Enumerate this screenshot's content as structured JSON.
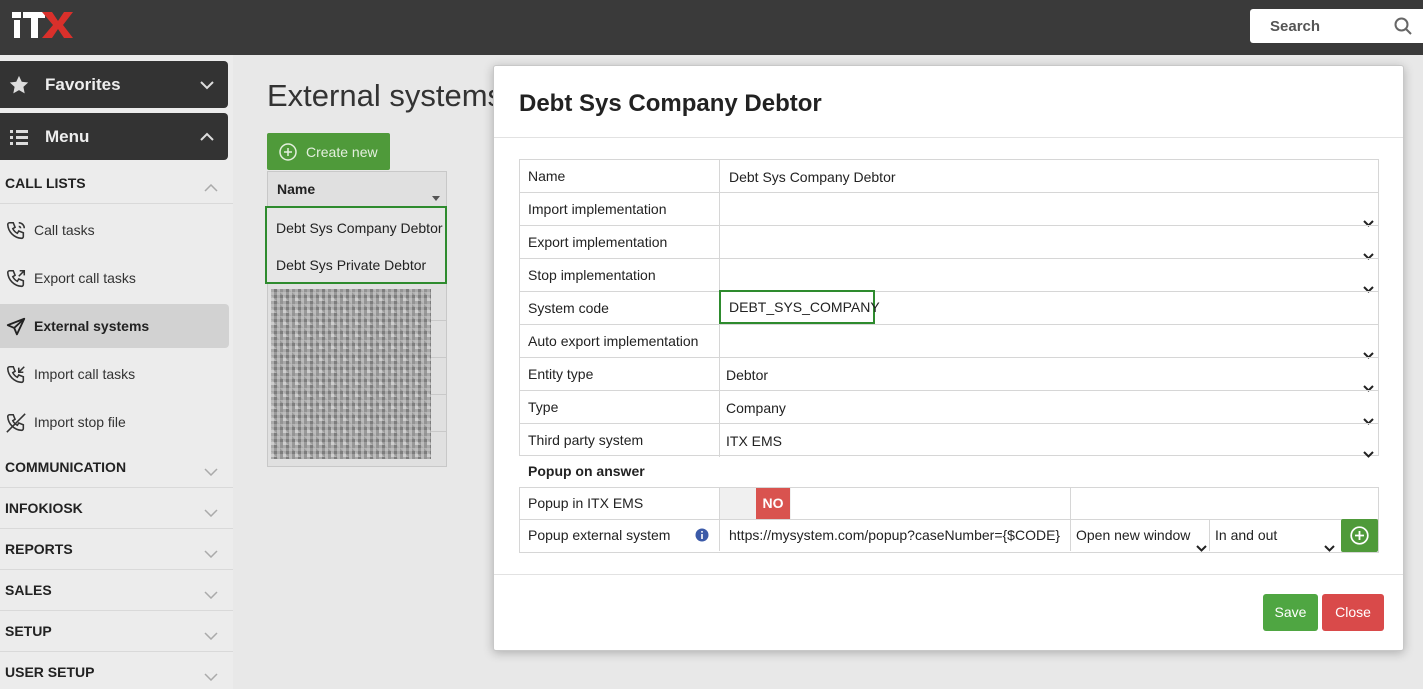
{
  "app": {
    "logo_text": "ITX"
  },
  "search": {
    "placeholder": "Search"
  },
  "sidebar": {
    "favorites_label": "Favorites",
    "menu_label": "Menu",
    "sections": {
      "call_lists": "CALL LISTS",
      "communication": "COMMUNICATION",
      "infokiosk": "INFOKIOSK",
      "reports": "REPORTS",
      "sales": "SALES",
      "setup": "SETUP",
      "user_setup": "USER SETUP"
    },
    "items": [
      {
        "label": "Call tasks",
        "icon": "phone-icon"
      },
      {
        "label": "Export call tasks",
        "icon": "phone-outgoing-icon"
      },
      {
        "label": "External systems",
        "icon": "send-icon",
        "active": true
      },
      {
        "label": "Import call tasks",
        "icon": "phone-incoming-icon"
      },
      {
        "label": "Import stop file",
        "icon": "phone-off-icon"
      }
    ]
  },
  "page": {
    "title": "External systems",
    "create_label": "Create new",
    "list": {
      "header": "Name",
      "rows": [
        "Debt Sys Company Debtor",
        "Debt Sys Private Debtor"
      ]
    }
  },
  "modal": {
    "title": "Debt Sys Company Debtor",
    "fields": {
      "name": {
        "label": "Name",
        "value": "Debt Sys Company Debtor"
      },
      "import_impl": {
        "label": "Import implementation",
        "value": ""
      },
      "export_impl": {
        "label": "Export implementation",
        "value": ""
      },
      "stop_impl": {
        "label": "Stop implementation",
        "value": ""
      },
      "system_code": {
        "label": "System code",
        "value": "DEBT_SYS_COMPANY"
      },
      "auto_export": {
        "label": "Auto export implementation",
        "value": ""
      },
      "entity_type": {
        "label": "Entity type",
        "value": "Debtor"
      },
      "type": {
        "label": "Type",
        "value": "Company"
      },
      "third_party": {
        "label": "Third party system",
        "value": "ITX EMS"
      }
    },
    "popup_section": "Popup on answer",
    "popup_itx": {
      "label": "Popup in ITX EMS",
      "toggle": "NO"
    },
    "popup_external": {
      "label": "Popup external system",
      "url": "https://mysystem.com/popup?caseNumber={$CODE}",
      "window_option": "Open new window",
      "direction_option": "In and out"
    },
    "save_label": "Save",
    "close_label": "Close"
  },
  "colors": {
    "accent_green": "#4f9a3a",
    "danger_red": "#d9534f",
    "topbar": "#3a3a3a"
  }
}
